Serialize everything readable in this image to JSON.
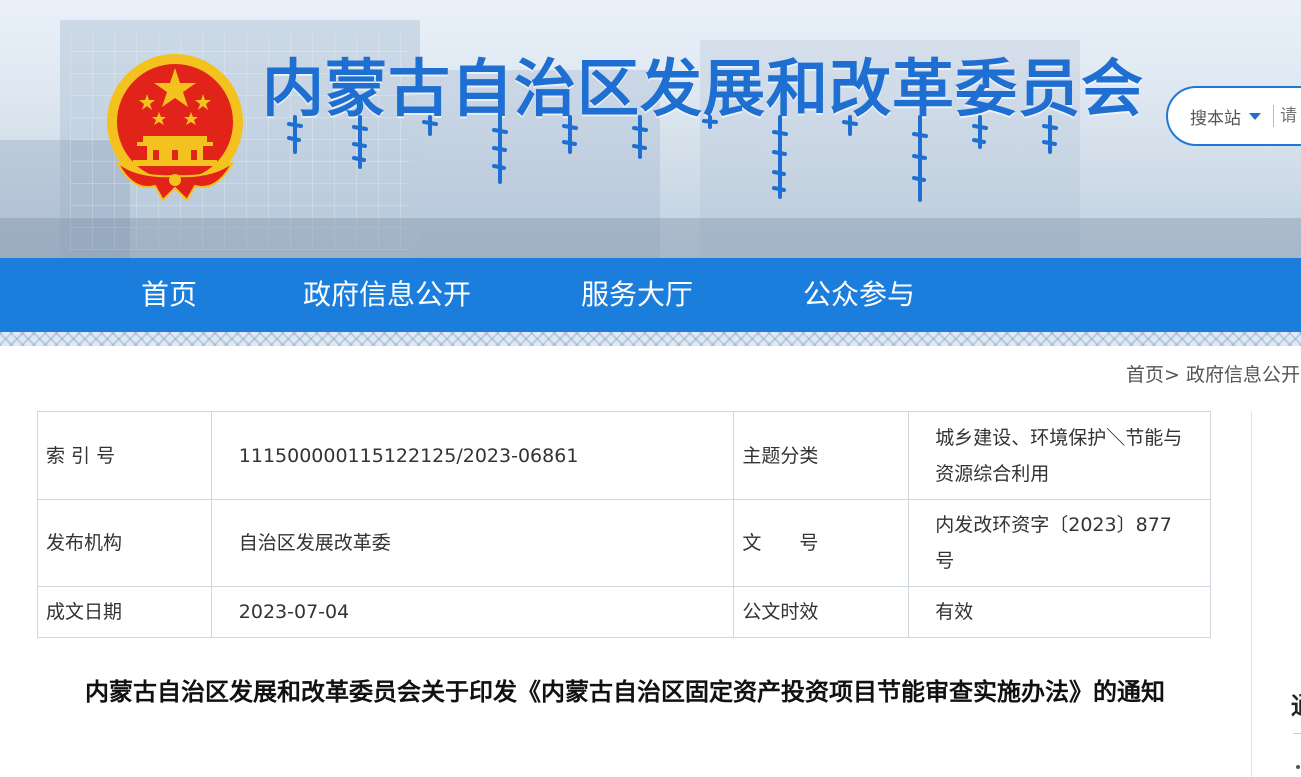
{
  "header": {
    "site_title": "内蒙古自治区发展和改革委员会",
    "mongolian_title_icon": "mongolian-script-title-icon",
    "emblem_icon": "national-emblem-icon",
    "search": {
      "scope_label": "搜本站",
      "placeholder": "请"
    }
  },
  "nav": {
    "items": [
      {
        "label": "首页"
      },
      {
        "label": "政府信息公开"
      },
      {
        "label": "服务大厅"
      },
      {
        "label": "公众参与"
      }
    ]
  },
  "breadcrumb": {
    "home": "首页",
    "separator": ">",
    "current": "政府信息公开"
  },
  "meta": {
    "rows": [
      {
        "label1": "索 引 号",
        "value1": "11150000011512212 5/2023-06861",
        "label2": "主题分类",
        "value2": "城乡建设、环境保护＼节能与资源综合利用"
      },
      {
        "label1": "发布机构",
        "value1": "自治区发展改革委",
        "label2": "文　　号",
        "value2": "内发改环资字〔2023〕877号"
      },
      {
        "label1": "成文日期",
        "value1": "2023-07-04",
        "label2": "公文时效",
        "value2": "有效"
      }
    ]
  },
  "article": {
    "title": "内蒙古自治区发展和改革委员会关于印发《内蒙古自治区固定资产投资项目节能审查实施办法》的通知"
  },
  "sidebar": {
    "partial_glyph": "通"
  },
  "colors": {
    "brand_blue": "#1b7ddc",
    "title_blue": "#1e6fd1",
    "emblem_red": "#e2231a",
    "emblem_gold": "#f4c21f"
  }
}
